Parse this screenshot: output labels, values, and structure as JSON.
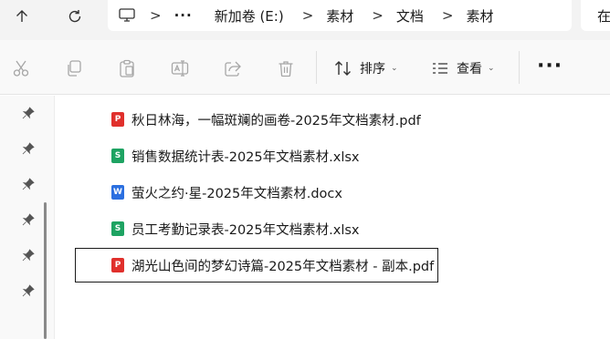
{
  "nav": {
    "back_icon": "arrow-up-icon",
    "refresh_icon": "refresh-icon"
  },
  "address": {
    "more": "···",
    "segments": [
      "新加卷 (E:)",
      "素材",
      "文档",
      "素材"
    ],
    "separator": ">"
  },
  "search": {
    "text": "在"
  },
  "toolbar": {
    "sort_label": "排序",
    "view_label": "查看",
    "more": "···"
  },
  "files": [
    {
      "name": "秋日林海，一幅斑斓的画卷-2025年文档素材.pdf",
      "type": "pdf",
      "badge": "P"
    },
    {
      "name": "销售数据统计表-2025年文档素材.xlsx",
      "type": "xlsx",
      "badge": "S"
    },
    {
      "name": "萤火之约·星-2025年文档素材.docx",
      "type": "docx",
      "badge": "W"
    },
    {
      "name": "员工考勤记录表-2025年文档素材.xlsx",
      "type": "xlsx",
      "badge": "S"
    },
    {
      "name": "湖光山色间的梦幻诗篇-2025年文档素材 - 副本.pdf",
      "type": "pdf",
      "badge": "P"
    }
  ],
  "colors": {
    "pdf": "#e0302c",
    "xlsx": "#1ea362",
    "docx": "#2b6fe0"
  }
}
